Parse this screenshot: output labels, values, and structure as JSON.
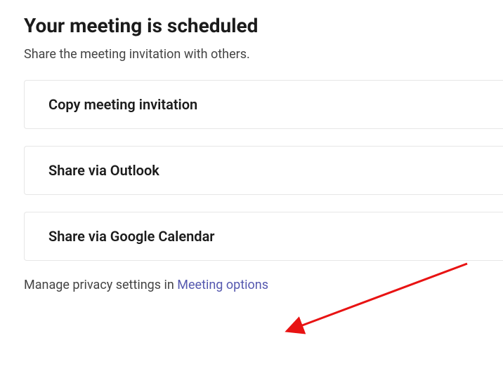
{
  "title": "Your meeting is scheduled",
  "subtitle": "Share the meeting invitation with others.",
  "options": {
    "copy": "Copy meeting invitation",
    "outlook": "Share via Outlook",
    "google": "Share via Google Calendar"
  },
  "footer": {
    "prefix": "Manage privacy settings in ",
    "link": "Meeting options"
  }
}
